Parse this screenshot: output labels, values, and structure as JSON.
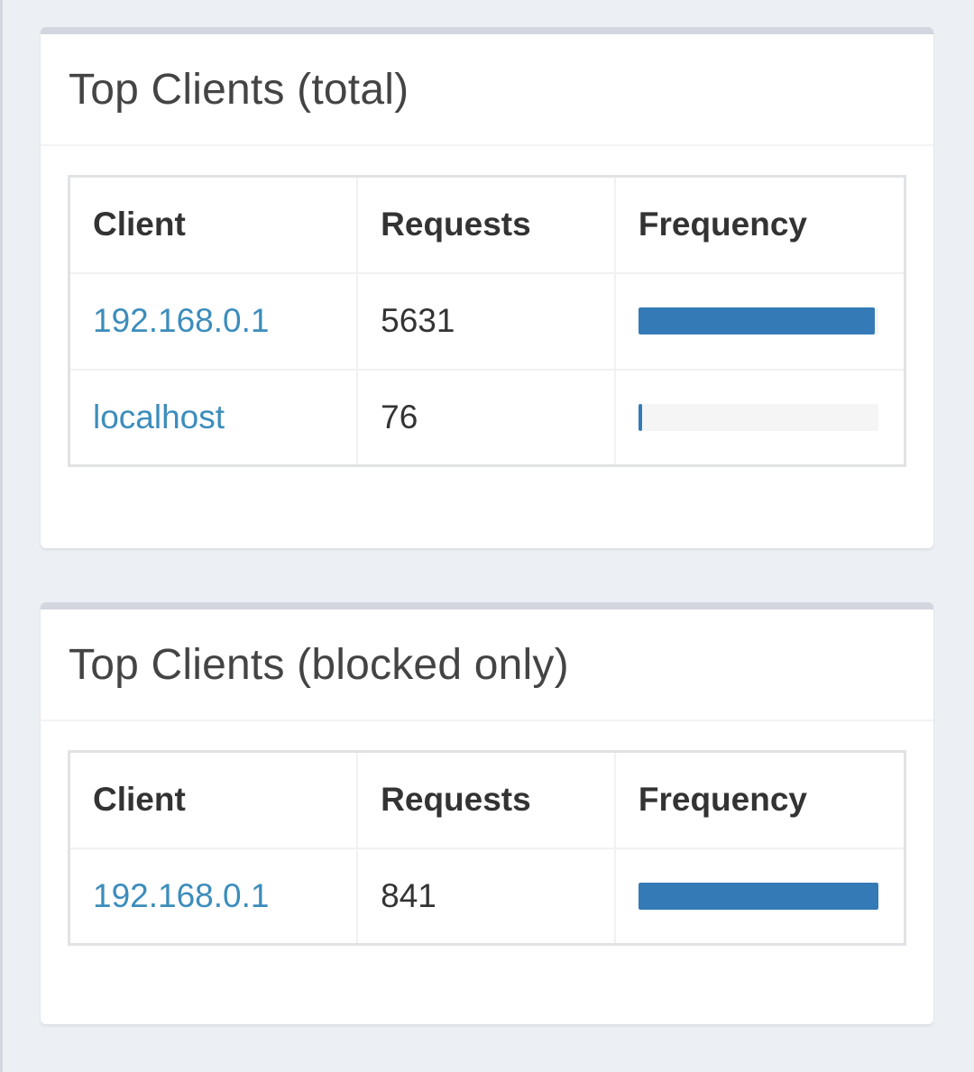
{
  "panels": [
    {
      "title": "Top Clients (total)",
      "headers": {
        "client": "Client",
        "requests": "Requests",
        "frequency": "Frequency"
      },
      "rows": [
        {
          "client": "192.168.0.1",
          "requests": "5631",
          "frequency_pct": 98.7
        },
        {
          "client": "localhost",
          "requests": "76",
          "frequency_pct": 1.3
        }
      ]
    },
    {
      "title": "Top Clients (blocked only)",
      "headers": {
        "client": "Client",
        "requests": "Requests",
        "frequency": "Frequency"
      },
      "rows": [
        {
          "client": "192.168.0.1",
          "requests": "841",
          "frequency_pct": 100
        }
      ]
    }
  ],
  "colors": {
    "background": "#ecf0f5",
    "link": "#3c8dbc",
    "bar": "#337ab7",
    "bar_track": "#f5f5f5",
    "box_top_border": "#d2d6de"
  }
}
